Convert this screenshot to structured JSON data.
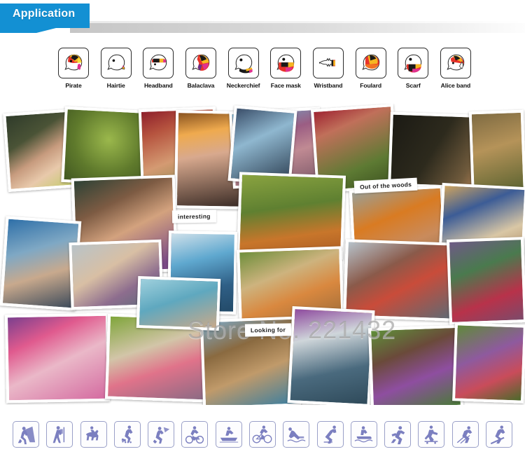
{
  "header": {
    "tab_label": "Application",
    "accent_color": "#1390d3",
    "bar_color": "#c6c6c6"
  },
  "application_icons": {
    "section_name": "wearing-styles",
    "items": [
      {
        "label": "Pirate",
        "icon": "head-pirate-icon"
      },
      {
        "label": "Hairtie",
        "icon": "head-hairtie-icon"
      },
      {
        "label": "Headband",
        "icon": "head-headband-icon"
      },
      {
        "label": "Balaclava",
        "icon": "head-balaclava-icon"
      },
      {
        "label": "Neckerchief",
        "icon": "head-neckerchief-icon"
      },
      {
        "label": "Face mask",
        "icon": "head-facemask-icon"
      },
      {
        "label": "Wristband",
        "icon": "wrist-wristband-icon"
      },
      {
        "label": "Foulard",
        "icon": "head-foulard-icon"
      },
      {
        "label": "Scarf",
        "icon": "head-scarf-icon"
      },
      {
        "label": "Alice band",
        "icon": "head-aliceband-icon"
      }
    ]
  },
  "collage": {
    "watermark": "Store No. 221432",
    "notes": [
      {
        "text": "interesting",
        "name": "note-interesting"
      },
      {
        "text": "Out of the woods",
        "name": "note-out-of-the-woods"
      },
      {
        "text": "Looking for",
        "name": "note-looking-for"
      }
    ],
    "photos": [
      {
        "name": "photo-group-red-scarves"
      },
      {
        "name": "photo-forest-canopy"
      },
      {
        "name": "photo-man-red-bandana"
      },
      {
        "name": "photo-woman-orange-headband"
      },
      {
        "name": "photo-beach-group-pink"
      },
      {
        "name": "photo-cap-sunglasses-man"
      },
      {
        "name": "photo-dark-camp"
      },
      {
        "name": "photo-smiling-man-purple"
      },
      {
        "name": "photo-blue-bandana-man"
      },
      {
        "name": "photo-woman-blue-headband"
      },
      {
        "name": "photo-blue-face-wrap"
      },
      {
        "name": "photo-raft-green-field"
      },
      {
        "name": "photo-orange-bandana-man"
      },
      {
        "name": "photo-cyclist-blue-bandana"
      },
      {
        "name": "photo-wood-totem"
      },
      {
        "name": "photo-beach-women-yellow"
      },
      {
        "name": "photo-group-glasses-outdoor"
      },
      {
        "name": "photo-seniors-neckwarmers"
      },
      {
        "name": "photo-pink-woman-tying"
      },
      {
        "name": "photo-couple-market"
      },
      {
        "name": "photo-beard-man-beach"
      },
      {
        "name": "photo-purple-cap-hiker"
      },
      {
        "name": "photo-purple-scarf-woman"
      },
      {
        "name": "photo-group-green-foliage"
      },
      {
        "name": "photo-teal-shirt"
      }
    ]
  },
  "sport_icons": {
    "section_name": "activities",
    "accent_color": "#7b7fc0",
    "items": [
      {
        "name": "climbing-icon"
      },
      {
        "name": "hiking-icon"
      },
      {
        "name": "horse-riding-icon"
      },
      {
        "name": "inline-skating-icon"
      },
      {
        "name": "snowboarding-icon"
      },
      {
        "name": "motocross-icon"
      },
      {
        "name": "rowing-icon"
      },
      {
        "name": "cycling-icon"
      },
      {
        "name": "swimming-icon"
      },
      {
        "name": "ice-skating-icon"
      },
      {
        "name": "jet-ski-icon"
      },
      {
        "name": "running-icon"
      },
      {
        "name": "skateboarding-icon"
      },
      {
        "name": "cross-country-ski-icon"
      },
      {
        "name": "downhill-ski-icon"
      }
    ]
  }
}
